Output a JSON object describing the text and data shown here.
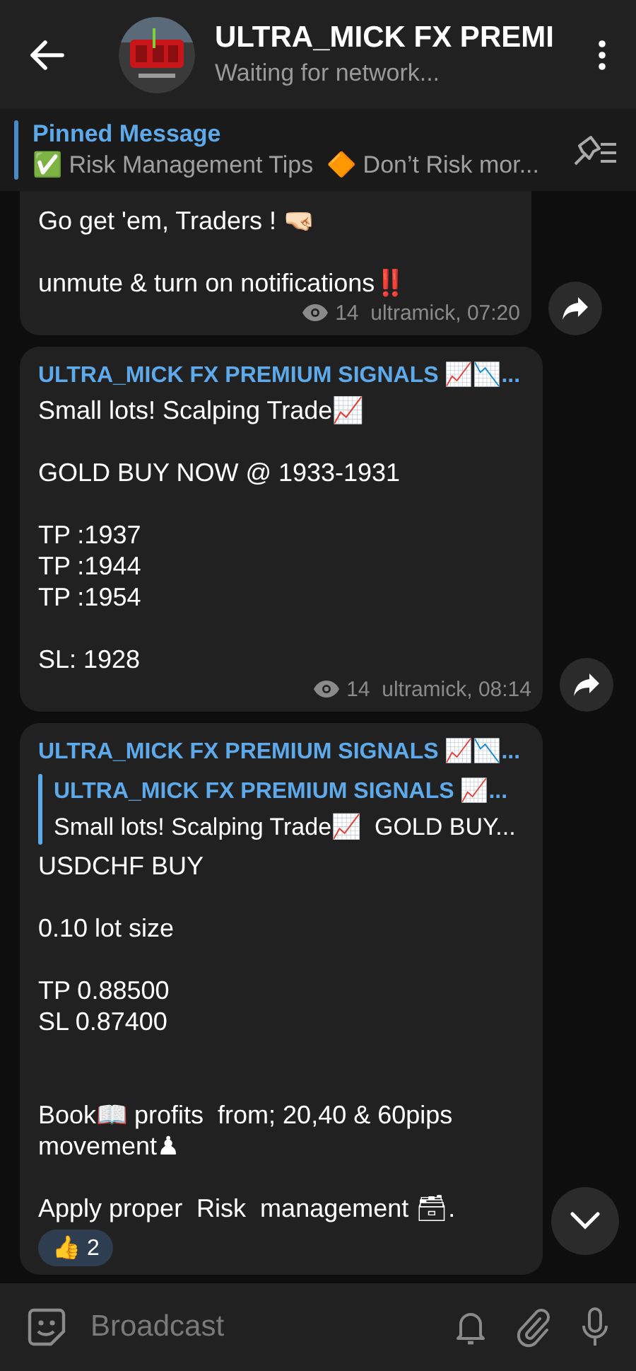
{
  "header": {
    "title": "ULTRA_MICK FX PREMI",
    "status": "Waiting for network..."
  },
  "pinned": {
    "label": "Pinned Message",
    "text": "✅ Risk Management Tips  🔶 Don’t Risk mor..."
  },
  "messages": [
    {
      "text": "Go get 'em, Traders ! 🤜🏻\n\nunmute & turn on notifications‼️",
      "views": "14",
      "signature": "ultramick, 07:20",
      "forward": true
    },
    {
      "author": "ULTRA_MICK FX PREMIUM SIGNALS 📈📉...",
      "text": "Small lots! Scalping Trade📈\n\nGOLD BUY NOW @ 1933-1931\n\nTP :1937\nTP :1944\nTP :1954\n\nSL: 1928",
      "views": "14",
      "signature": "ultramick, 08:14",
      "forward": true
    },
    {
      "author": "ULTRA_MICK FX PREMIUM SIGNALS 📈📉...",
      "reply": {
        "author": "ULTRA_MICK FX PREMIUM SIGNALS 📈...",
        "text": "Small lots! Scalping Trade📈  GOLD BUY..."
      },
      "text": "USDCHF BUY\n\n0.10 lot size\n\nTP 0.88500\nSL 0.87400\n\n\nBook📖 profits  from; 20,40 & 60pips movement♟\n\nApply proper  Risk  management 🗃.",
      "reaction": {
        "emoji": "👍",
        "count": "2"
      },
      "forward": false
    }
  ],
  "composer": {
    "placeholder": "Broadcast"
  }
}
